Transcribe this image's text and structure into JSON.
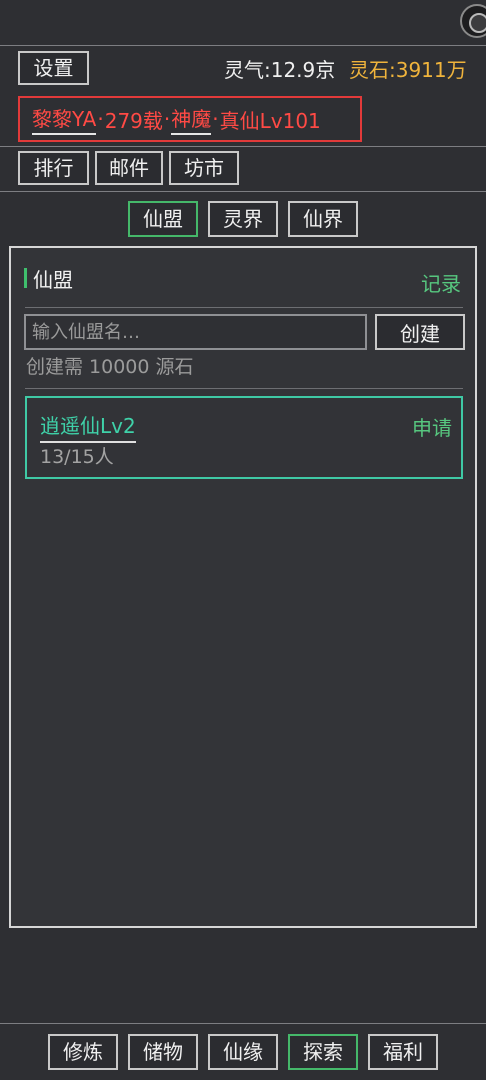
{
  "header": {
    "settings_label": "设置",
    "qi_label": "灵气:12.9京",
    "stone_label": "灵石:3911万"
  },
  "identity": {
    "player": "黎黎YA",
    "age": "279载",
    "realm": "神魔",
    "rank": "真仙Lv101",
    "separator": "·"
  },
  "nav": {
    "rank_label": "排行",
    "mail_label": "邮件",
    "market_label": "坊市"
  },
  "tabs": {
    "items": [
      {
        "label": "仙盟",
        "active": true
      },
      {
        "label": "灵界",
        "active": false
      },
      {
        "label": "仙界",
        "active": false
      }
    ]
  },
  "panel": {
    "title": "仙盟",
    "record_label": "记录",
    "input_placeholder": "输入仙盟名…",
    "create_label": "创建",
    "cost_text": "创建需 10000 源石"
  },
  "guilds": [
    {
      "name": "逍遥仙Lv2",
      "members": "13/15人",
      "action": "申请"
    }
  ],
  "bottom_nav": {
    "items": [
      {
        "label": "修炼",
        "active": false
      },
      {
        "label": "储物",
        "active": false
      },
      {
        "label": "仙缘",
        "active": false
      },
      {
        "label": "探索",
        "active": true
      },
      {
        "label": "福利",
        "active": false
      }
    ]
  },
  "colors": {
    "background": "#2e2f33",
    "accent_green": "#45b86a",
    "accent_teal": "#3fc9a5",
    "danger_red": "#e23a3a",
    "gold": "#f0b43c"
  }
}
